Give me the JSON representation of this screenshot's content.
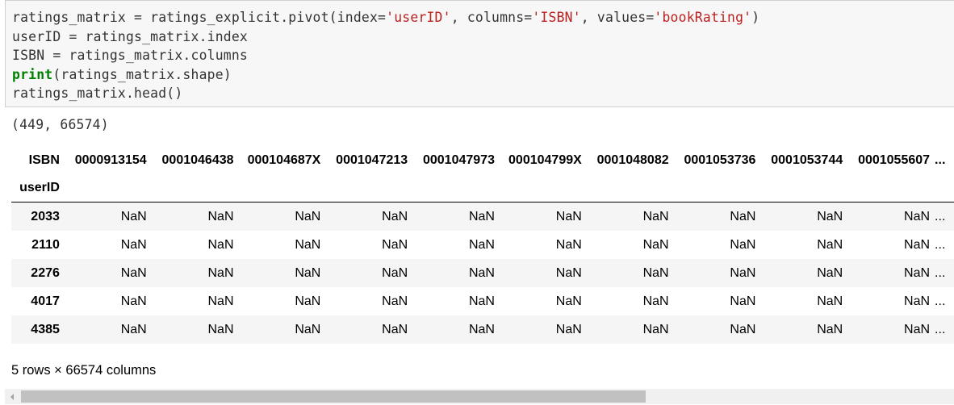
{
  "code": {
    "line1_a": "ratings_matrix = ratings_explicit.pivot(index=",
    "line1_s1": "'userID'",
    "line1_b": ", columns=",
    "line1_s2": "'ISBN'",
    "line1_c": ", values=",
    "line1_s3": "'bookRating'",
    "line1_d": ")",
    "line2": "userID = ratings_matrix.index",
    "line3": "ISBN = ratings_matrix.columns",
    "line4_kw": "print",
    "line4_rest": "(ratings_matrix.shape)",
    "line5": "ratings_matrix.head()"
  },
  "output": {
    "shape": "(449, 66574)"
  },
  "dataframe": {
    "columns_name": "ISBN",
    "index_name": "userID",
    "columns": [
      "0000913154",
      "0001046438",
      "000104687X",
      "0001047213",
      "0001047973",
      "000104799X",
      "0001048082",
      "0001053736",
      "0001053744",
      "0001055607"
    ],
    "ellipsis": "...",
    "rows": [
      {
        "index": "2033",
        "values": [
          "NaN",
          "NaN",
          "NaN",
          "NaN",
          "NaN",
          "NaN",
          "NaN",
          "NaN",
          "NaN",
          "NaN"
        ]
      },
      {
        "index": "2110",
        "values": [
          "NaN",
          "NaN",
          "NaN",
          "NaN",
          "NaN",
          "NaN",
          "NaN",
          "NaN",
          "NaN",
          "NaN"
        ]
      },
      {
        "index": "2276",
        "values": [
          "NaN",
          "NaN",
          "NaN",
          "NaN",
          "NaN",
          "NaN",
          "NaN",
          "NaN",
          "NaN",
          "NaN"
        ]
      },
      {
        "index": "4017",
        "values": [
          "NaN",
          "NaN",
          "NaN",
          "NaN",
          "NaN",
          "NaN",
          "NaN",
          "NaN",
          "NaN",
          "NaN"
        ]
      },
      {
        "index": "4385",
        "values": [
          "NaN",
          "NaN",
          "NaN",
          "NaN",
          "NaN",
          "NaN",
          "NaN",
          "NaN",
          "NaN",
          "NaN"
        ]
      }
    ],
    "caption": "5 rows × 66574 columns"
  },
  "scrollbar": {
    "arrow_icon": "chevron-left-icon"
  }
}
